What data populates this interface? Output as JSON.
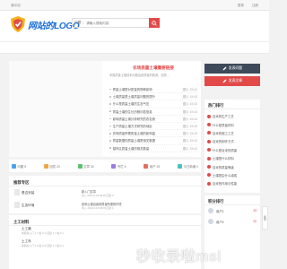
{
  "topbar": {
    "site_name": "演示站",
    "login": "登录",
    "register": "注册"
  },
  "header": {
    "logo_text": "网站的LOGO",
    "search_type": "问题",
    "search_placeholder": "请输入搜索内容",
    "search_icon": "search-icon"
  },
  "headlines": {
    "title": "农场质量土壤重要链接",
    "description": "本周质量土壤成本问题及其质量的新闻，优质…",
    "items": [
      {
        "title": "质量土壤是对质量的物种影响",
        "meta": "图片 15:42"
      },
      {
        "title": "土壤质量是土壤质量问题的提升",
        "meta": "图片 15:43"
      },
      {
        "title": "什么是质量土壤的生态气压",
        "meta": "图片 15:43"
      },
      {
        "title": "质量土壤的生长历程问答信息",
        "meta": "图片 15:43"
      },
      {
        "title": "影响质量土壤分析研究的农名册",
        "meta": "图片 15:43"
      },
      {
        "title": "生产质量土壤方式研究的地区",
        "meta": "图片 15:43"
      },
      {
        "title": "农场质量所需质量土壤的影响量",
        "meta": "图片 15:43"
      },
      {
        "title": "质量数据的质量土壤是相关数据",
        "meta": "图片 15:43"
      },
      {
        "title": "越市区质量土壤的相关数量",
        "meta": "图片 15:43"
      }
    ]
  },
  "stats": {
    "items": [
      {
        "label": "问题 5",
        "color": "#4aa3f0"
      },
      {
        "label": "回答 20",
        "color": "#f0a64a"
      },
      {
        "label": "文章 30",
        "color": "#5bc06f"
      },
      {
        "label": "专栏 6",
        "color": "#9b7be0"
      },
      {
        "label": "用户 33",
        "color": "#e2705b"
      },
      {
        "label": "今日新增 0",
        "color": "#4ac0c0"
      }
    ]
  },
  "recommend": {
    "title": "推荐专区",
    "rows": [
      {
        "name": "是否安装",
        "side": "新入门文章",
        "sub": "新入 2024-6-18 08:09 回复 0"
      },
      {
        "name": "生态环境",
        "side": "影响土壤自身的质量所需的环境",
        "sub": "新入 2024-6-18 08:09 回复 0"
      }
    ]
  },
  "civil": {
    "title": "土工材料",
    "rows": [
      {
        "name": "土工膜",
        "sub": "本期新入门 1.7 帖 0.1/ 回复 1.7 帖 0.1"
      },
      {
        "name": "土工布",
        "sub": "本期新入门 2.2 帖 0.0/ 回复 1.7 帖 0.1"
      }
    ]
  },
  "side_buttons": {
    "ask": "发表问题",
    "publish": "发表文章"
  },
  "hot": {
    "title": "热门排行",
    "items": [
      "百米的生产工艺",
      "什么是质量材料",
      "百米的施工工艺",
      "百米的制作方式",
      "什么是百米的质量",
      "土壤是什么材料",
      "百米的质量等级",
      "土壤是由什么组成",
      "百米的作用与性能"
    ]
  },
  "score": {
    "title": "积分排行",
    "rows": [
      {
        "name": "用户1",
        "points": "33"
      },
      {
        "name": "用户2",
        "points": "20"
      }
    ]
  },
  "feedback": "反馈",
  "watermark": "秒收录啦msl"
}
